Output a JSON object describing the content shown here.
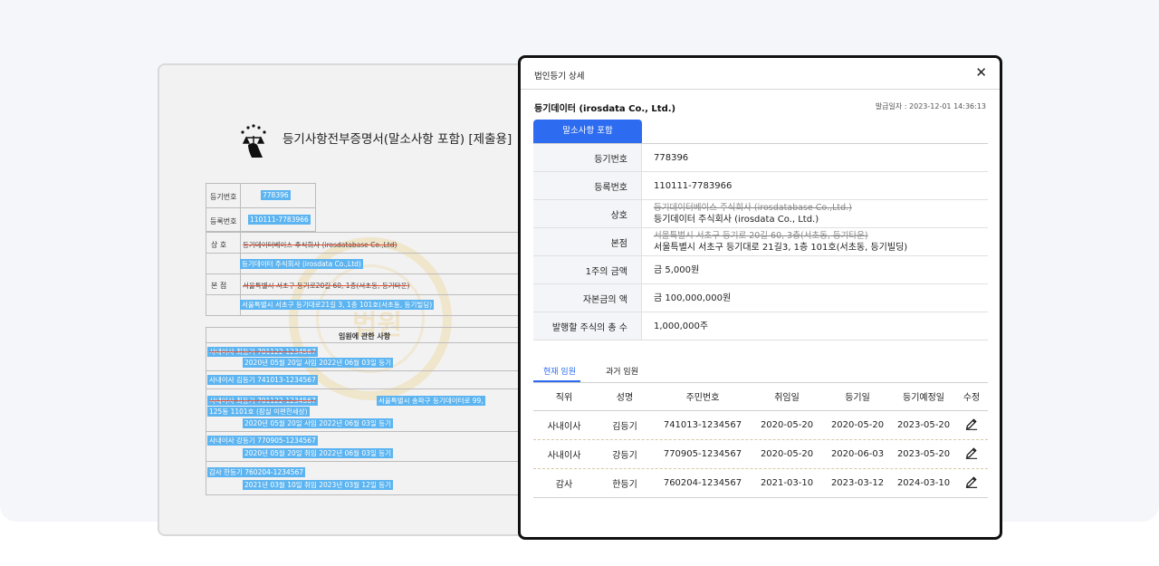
{
  "certificate": {
    "title": "등기사항전부증명서(말소사항 포함) [제출용]",
    "reg_no_label": "등기번호",
    "reg_no": "778396",
    "biz_no_label": "등록번호",
    "biz_no": "110111-7783966",
    "name_label": "상  호",
    "name_old": "등기데이터베이스 주식회사 (irosdatabase Co.,Ltd)",
    "name_new": "등기데이터 주식회사 (irosdata Co.,Ltd)",
    "office_label": "본  점",
    "office_old": "서울특별시 서초구 등기로20길 60, 1층(서초동, 등기타운)",
    "office_new": "서울특별시 서초구 등기대로21길 3, 1층 101호(서초동, 등기빌딩)",
    "officers_title": "임원에 관한 사항",
    "officers": [
      {
        "l1": "사내이사     최등기          701122-1234567",
        "l2": "2020년  05월  20일  사임             2022년  06월  03일  등기"
      },
      {
        "l1": "사내이사     김등기          741013-1234567"
      },
      {
        "l1": "사내이사     최등기          701122-1234567",
        "l1b": "서울특별시 송파구 등기데이터로 99,",
        "l1c": "125동 1101호 (잠실 이편한세상)",
        "l2": "2020년  05월  20일  사임             2022년  06월  03일  등기"
      },
      {
        "l1": "사내이사     강등기          770905-1234567",
        "l2": "2020년  05월  20일  취임             2022년  06월  03일  등기"
      },
      {
        "l1": "감사             한등기          760204-1234567",
        "l2": "2021년  03월  10일  취임             2023년  03월  12일  등기"
      }
    ]
  },
  "modal": {
    "title": "법인등기 상세",
    "close_icon": "close-icon",
    "company": "등기데이터 (irosdata Co., Ltd.)",
    "issued": "발급일자 : 2023-12-01 14:36:13",
    "tab_label": "말소사항 포함",
    "info": [
      {
        "label": "등기번호",
        "value": "778396"
      },
      {
        "label": "등록번호",
        "value": "110111-7783966"
      },
      {
        "label": "상호",
        "old": "등기데이터베이스 주식회사 (irosdatabase Co.,Ltd.)",
        "value": "등기데이터 주식회사 (irosdata Co., Ltd.)"
      },
      {
        "label": "본점",
        "old": "서울특별시 서초구 등기로 20길 60, 3층(서초동, 등기타운)",
        "value": "서울특별시 서초구 등기대로 21길3, 1층 101호(서초동, 등기빌딩)"
      },
      {
        "label": "1주의 금액",
        "value": "금 5,000원"
      },
      {
        "label": "자본금의 액",
        "value": "금 100,000,000원"
      },
      {
        "label": "발행할 주식의 총 수",
        "value": "1,000,000주"
      }
    ],
    "subtabs": [
      "현재 임원",
      "과거 임원"
    ],
    "columns": [
      "직위",
      "성명",
      "주민번호",
      "취임일",
      "등기일",
      "등기예정일",
      "수정"
    ],
    "rows": [
      [
        "사내이사",
        "김등기",
        "741013-1234567",
        "2020-05-20",
        "2020-05-20",
        "2023-05-20"
      ],
      [
        "사내이사",
        "강등기",
        "770905-1234567",
        "2020-05-20",
        "2020-06-03",
        "2023-05-20"
      ],
      [
        "감사",
        "한등기",
        "760204-1234567",
        "2021-03-10",
        "2023-03-12",
        "2024-03-10"
      ]
    ],
    "edit_icon": "pencil-icon"
  }
}
